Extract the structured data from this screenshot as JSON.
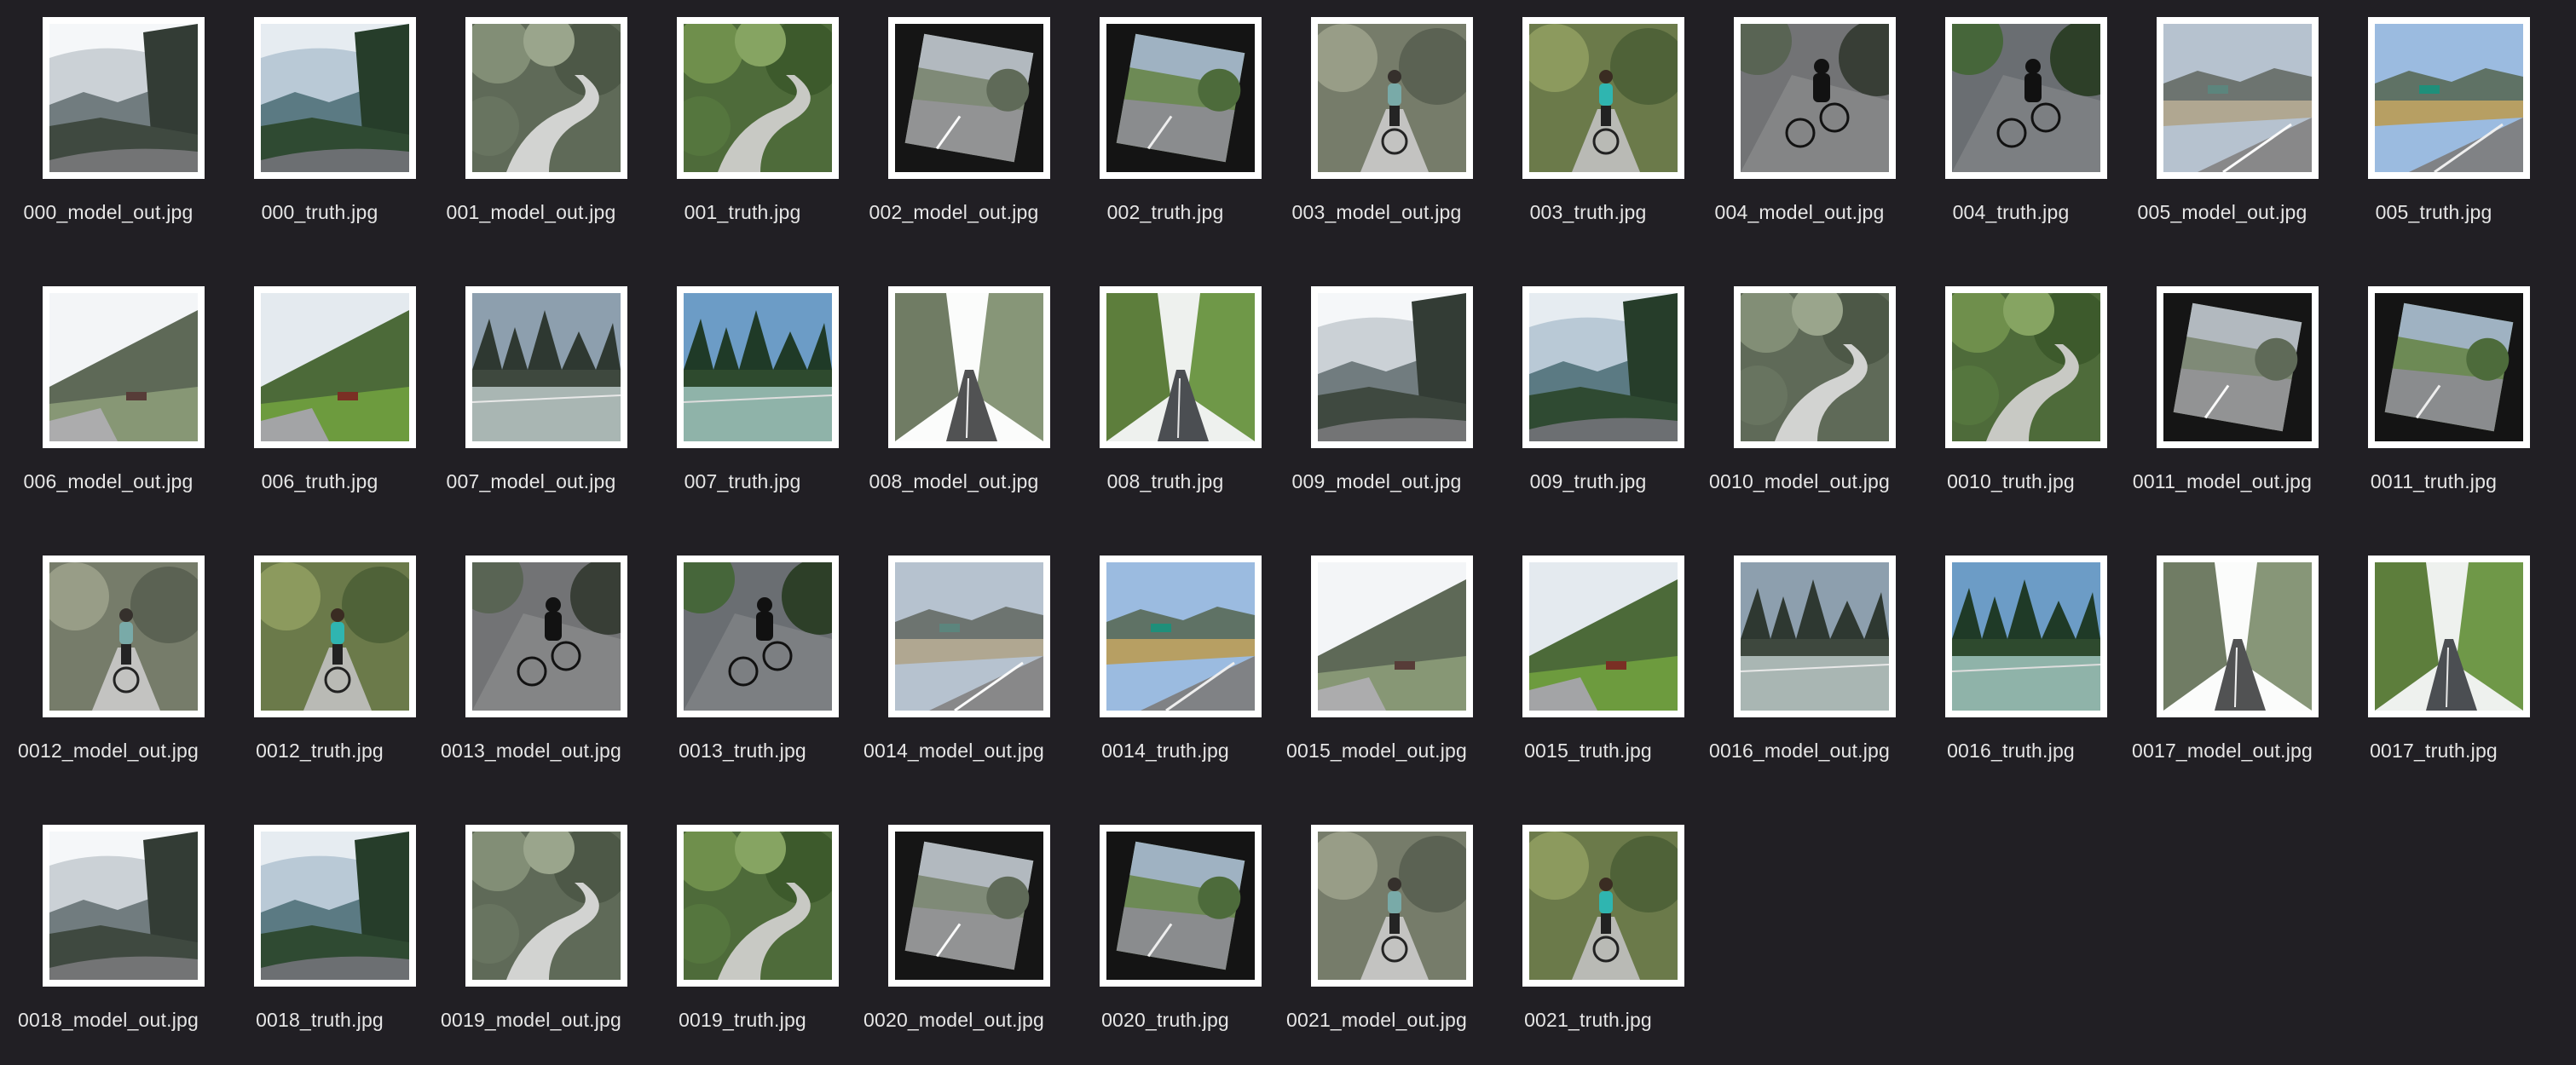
{
  "window": {
    "background": "#211f24"
  },
  "files": [
    {
      "name": "000_model_out.jpg",
      "scene": "mountain-road",
      "desaturated": true,
      "rotated": false
    },
    {
      "name": "000_truth.jpg",
      "scene": "mountain-road",
      "desaturated": false,
      "rotated": false
    },
    {
      "name": "001_model_out.jpg",
      "scene": "forest-path",
      "desaturated": true,
      "rotated": false
    },
    {
      "name": "001_truth.jpg",
      "scene": "forest-path",
      "desaturated": false,
      "rotated": false
    },
    {
      "name": "002_model_out.jpg",
      "scene": "road-curve",
      "desaturated": true,
      "rotated": true
    },
    {
      "name": "002_truth.jpg",
      "scene": "road-curve",
      "desaturated": false,
      "rotated": true
    },
    {
      "name": "003_model_out.jpg",
      "scene": "cyclist-teal",
      "desaturated": true,
      "rotated": false
    },
    {
      "name": "003_truth.jpg",
      "scene": "cyclist-teal",
      "desaturated": false,
      "rotated": false
    },
    {
      "name": "004_model_out.jpg",
      "scene": "cyclist-dark",
      "desaturated": true,
      "rotated": false
    },
    {
      "name": "004_truth.jpg",
      "scene": "cyclist-dark",
      "desaturated": false,
      "rotated": false
    },
    {
      "name": "005_model_out.jpg",
      "scene": "highway-sign",
      "desaturated": true,
      "rotated": false
    },
    {
      "name": "005_truth.jpg",
      "scene": "highway-sign",
      "desaturated": false,
      "rotated": false
    },
    {
      "name": "006_model_out.jpg",
      "scene": "hillside-road",
      "desaturated": true,
      "rotated": false
    },
    {
      "name": "006_truth.jpg",
      "scene": "hillside-road",
      "desaturated": false,
      "rotated": false
    },
    {
      "name": "007_model_out.jpg",
      "scene": "pine-road",
      "desaturated": true,
      "rotated": false
    },
    {
      "name": "007_truth.jpg",
      "scene": "pine-road",
      "desaturated": false,
      "rotated": false
    },
    {
      "name": "008_model_out.jpg",
      "scene": "wet-road",
      "desaturated": true,
      "rotated": false
    },
    {
      "name": "008_truth.jpg",
      "scene": "wet-road",
      "desaturated": false,
      "rotated": false
    },
    {
      "name": "009_model_out.jpg",
      "scene": "mountain-road",
      "desaturated": true,
      "rotated": false
    },
    {
      "name": "009_truth.jpg",
      "scene": "mountain-road",
      "desaturated": false,
      "rotated": false
    },
    {
      "name": "0010_model_out.jpg",
      "scene": "forest-path",
      "desaturated": true,
      "rotated": false
    },
    {
      "name": "0010_truth.jpg",
      "scene": "forest-path",
      "desaturated": false,
      "rotated": false
    },
    {
      "name": "0011_model_out.jpg",
      "scene": "road-curve",
      "desaturated": true,
      "rotated": true
    },
    {
      "name": "0011_truth.jpg",
      "scene": "road-curve",
      "desaturated": false,
      "rotated": true
    },
    {
      "name": "0012_model_out.jpg",
      "scene": "cyclist-teal",
      "desaturated": true,
      "rotated": false
    },
    {
      "name": "0012_truth.jpg",
      "scene": "cyclist-teal",
      "desaturated": false,
      "rotated": false
    },
    {
      "name": "0013_model_out.jpg",
      "scene": "cyclist-dark",
      "desaturated": true,
      "rotated": false
    },
    {
      "name": "0013_truth.jpg",
      "scene": "cyclist-dark",
      "desaturated": false,
      "rotated": false
    },
    {
      "name": "0014_model_out.jpg",
      "scene": "highway-sign",
      "desaturated": true,
      "rotated": false
    },
    {
      "name": "0014_truth.jpg",
      "scene": "highway-sign",
      "desaturated": false,
      "rotated": false
    },
    {
      "name": "0015_model_out.jpg",
      "scene": "hillside-road",
      "desaturated": true,
      "rotated": false
    },
    {
      "name": "0015_truth.jpg",
      "scene": "hillside-road",
      "desaturated": false,
      "rotated": false
    },
    {
      "name": "0016_model_out.jpg",
      "scene": "pine-road",
      "desaturated": true,
      "rotated": false
    },
    {
      "name": "0016_truth.jpg",
      "scene": "pine-road",
      "desaturated": false,
      "rotated": false
    },
    {
      "name": "0017_model_out.jpg",
      "scene": "wet-road",
      "desaturated": true,
      "rotated": false
    },
    {
      "name": "0017_truth.jpg",
      "scene": "wet-road",
      "desaturated": false,
      "rotated": false
    },
    {
      "name": "0018_model_out.jpg",
      "scene": "mountain-road",
      "desaturated": true,
      "rotated": false
    },
    {
      "name": "0018_truth.jpg",
      "scene": "mountain-road",
      "desaturated": false,
      "rotated": false
    },
    {
      "name": "0019_model_out.jpg",
      "scene": "forest-path",
      "desaturated": true,
      "rotated": false
    },
    {
      "name": "0019_truth.jpg",
      "scene": "forest-path",
      "desaturated": false,
      "rotated": false
    },
    {
      "name": "0020_model_out.jpg",
      "scene": "road-curve",
      "desaturated": true,
      "rotated": true
    },
    {
      "name": "0020_truth.jpg",
      "scene": "road-curve",
      "desaturated": false,
      "rotated": true
    },
    {
      "name": "0021_model_out.jpg",
      "scene": "cyclist-teal",
      "desaturated": true,
      "rotated": false
    },
    {
      "name": "0021_truth.jpg",
      "scene": "cyclist-teal",
      "desaturated": false,
      "rotated": false
    }
  ]
}
